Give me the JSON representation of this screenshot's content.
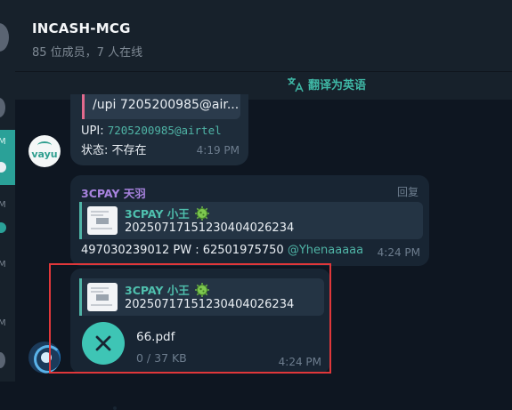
{
  "sidebar_strip": {
    "letters": [
      "M",
      "M",
      "M",
      "M"
    ]
  },
  "header": {
    "title": "INCASH-MCG",
    "subtitle": "85 位成员，7 人在线",
    "translate_label": "翻译为英语"
  },
  "messages": [
    {
      "quote_text": "/upi 7205200985@air...",
      "upi_label": "UPI: ",
      "upi_value": "7205200985@airtel",
      "status": "状态: 不存在",
      "time": "4:19 PM",
      "avatar_text": "vayu"
    },
    {
      "sender": "3CPAY 天羽",
      "reply_label": "回复",
      "quote_name": "3CPAY 小王",
      "quote_text": "20250717151230404026234",
      "body": "497030239012  PW : 62501975750 ",
      "mention": "@Yhenaaaaa",
      "time": "4:24 PM"
    },
    {
      "quote_name": "3CPAY 小王",
      "quote_text": "20250717151230404026234",
      "file_name": "66.pdf",
      "file_size": "0 / 37 KB",
      "time": "4:24 PM"
    }
  ],
  "colors": {
    "accent": "#3ec5b5",
    "sender_purple": "#a883df",
    "highlight": "#e0373a"
  }
}
